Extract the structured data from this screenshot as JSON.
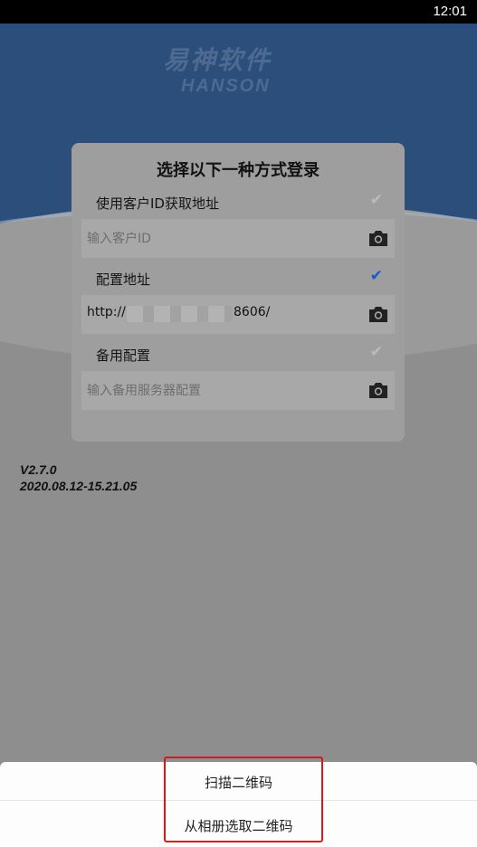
{
  "status_bar": {
    "time": "12:01"
  },
  "brand": {
    "logo_cn": "易神软件",
    "logo_en": "HANSON"
  },
  "dialog": {
    "title": "选择以下一种方式登录",
    "options": [
      {
        "label": "使用客户ID获取地址",
        "checked": false,
        "field_value": "",
        "field_placeholder": "输入客户ID"
      },
      {
        "label": "配置地址",
        "checked": true,
        "field_value_prefix": "http://",
        "field_value_suffix": "8606/",
        "field_placeholder": ""
      },
      {
        "label": "备用配置",
        "checked": false,
        "field_value": "",
        "field_placeholder": "输入备用服务器配置"
      }
    ],
    "check_glyph": "✔",
    "camera_icon": "camera-icon"
  },
  "version": {
    "number": "V2.7.0",
    "build": "2020.08.12-15.21.05"
  },
  "sheet": {
    "scan_qr": "扫描二维码",
    "pick_from_album": "从相册选取二维码"
  },
  "colors": {
    "accent": "#1a5ad0",
    "highlight": "#e01515",
    "header_blue": "#2c4e7a"
  }
}
